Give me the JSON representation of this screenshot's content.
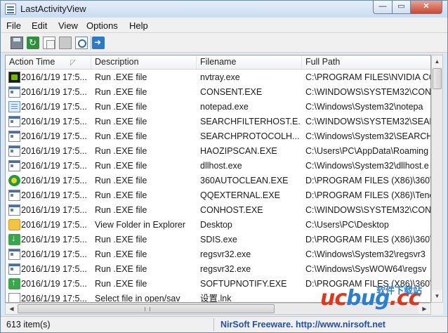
{
  "window": {
    "title": "LastActivityView"
  },
  "menu": [
    "File",
    "Edit",
    "View",
    "Options",
    "Help"
  ],
  "columns": [
    "Action Time",
    "Description",
    "Filename",
    "Full Path"
  ],
  "rows": [
    {
      "icon": "nvidia-icon",
      "time": "2016/1/19 17:5...",
      "desc": "Run .EXE file",
      "file": "nvtray.exe",
      "path": "C:\\PROGRAM FILES\\NVIDIA CO"
    },
    {
      "icon": "exe-icon",
      "time": "2016/1/19 17:5...",
      "desc": "Run .EXE file",
      "file": "CONSENT.EXE",
      "path": "C:\\WINDOWS\\SYSTEM32\\CON"
    },
    {
      "icon": "notepad-icon",
      "time": "2016/1/19 17:5...",
      "desc": "Run .EXE file",
      "file": "notepad.exe",
      "path": "C:\\Windows\\System32\\notepa"
    },
    {
      "icon": "exe-icon",
      "time": "2016/1/19 17:5...",
      "desc": "Run .EXE file",
      "file": "SEARCHFILTERHOST.E...",
      "path": "C:\\WINDOWS\\SYSTEM32\\SEARCH"
    },
    {
      "icon": "exe-icon",
      "time": "2016/1/19 17:5...",
      "desc": "Run .EXE file",
      "file": "SEARCHPROTOCOLH...",
      "path": "C:\\Windows\\System32\\SEARCH"
    },
    {
      "icon": "exe-icon",
      "time": "2016/1/19 17:5...",
      "desc": "Run .EXE file",
      "file": "HAOZIPSCAN.EXE",
      "path": "C:\\Users\\PC\\AppData\\Roaming"
    },
    {
      "icon": "exe-icon",
      "time": "2016/1/19 17:5...",
      "desc": "Run .EXE file",
      "file": "dllhost.exe",
      "path": "C:\\Windows\\System32\\dllhost.e"
    },
    {
      "icon": "360-icon",
      "time": "2016/1/19 17:5...",
      "desc": "Run .EXE file",
      "file": "360AUTOCLEAN.EXE",
      "path": "D:\\PROGRAM FILES (X86)\\360\\"
    },
    {
      "icon": "exe-icon",
      "time": "2016/1/19 17:5...",
      "desc": "Run .EXE file",
      "file": "QQEXTERNAL.EXE",
      "path": "D:\\PROGRAM FILES (X86)\\Tenc"
    },
    {
      "icon": "exe-icon",
      "time": "2016/1/19 17:5...",
      "desc": "Run .EXE file",
      "file": "CONHOST.EXE",
      "path": "C:\\WINDOWS\\SYSTEM32\\CON"
    },
    {
      "icon": "folder-icon",
      "time": "2016/1/19 17:5...",
      "desc": "View Folder in Explorer",
      "file": "Desktop",
      "path": "C:\\Users\\PC\\Desktop"
    },
    {
      "icon": "sdis-icon",
      "time": "2016/1/19 17:5...",
      "desc": "Run .EXE file",
      "file": "SDIS.exe",
      "path": "D:\\PROGRAM FILES (X86)\\360\\"
    },
    {
      "icon": "exe-icon",
      "time": "2016/1/19 17:5...",
      "desc": "Run .EXE file",
      "file": "regsvr32.exe",
      "path": "C:\\Windows\\System32\\regsvr3"
    },
    {
      "icon": "exe-icon",
      "time": "2016/1/19 17:5...",
      "desc": "Run .EXE file",
      "file": "regsvr32.exe",
      "path": "C:\\Windows\\SysWOW64\\regsv"
    },
    {
      "icon": "update-icon",
      "time": "2016/1/19 17:5...",
      "desc": "Run .EXE file",
      "file": "SOFTUPNOTIFY.EXE",
      "path": "D:\\PROGRAM FILES (X86)\\360\\"
    },
    {
      "icon": "document-icon",
      "time": "2016/1/19 17:5...",
      "desc": "Select file in open/sav",
      "file": "设置.lnk",
      "path": ""
    }
  ],
  "status": {
    "count": "613 item(s)",
    "link": "NirSoft Freeware.  http://www.nirsoft.net"
  },
  "watermark": {
    "logo_a": "uc",
    "logo_b": "bug",
    "logo_c": ".cc",
    "sub": "软件下载站"
  }
}
